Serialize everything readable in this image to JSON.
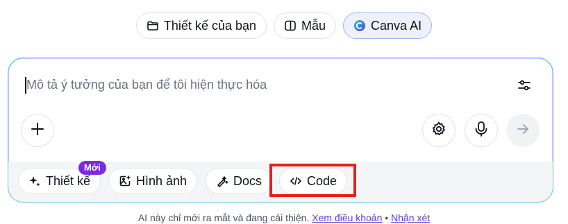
{
  "tabs": [
    {
      "label": "Thiết kế của bạn",
      "icon": "folder-icon"
    },
    {
      "label": "Mẫu",
      "icon": "template-icon"
    },
    {
      "label": "Canva AI",
      "icon": "canva-ai-icon",
      "active": true
    }
  ],
  "prompt": {
    "placeholder": "Mô tả ý tưởng của bạn để tôi hiện thực hóa"
  },
  "chips": [
    {
      "label": "Thiết kế",
      "icon": "sparkle-icon"
    },
    {
      "label": "Hình ảnh",
      "icon": "image-icon"
    },
    {
      "label": "Docs",
      "icon": "magic-pen-icon"
    },
    {
      "label": "Code",
      "icon": "code-icon"
    }
  ],
  "badge": "Mới",
  "footer": {
    "text": "AI này chỉ mới ra mắt và đang cải thiện.",
    "terms_link": "Xem điều khoản",
    "separator": "•",
    "feedback_link": "Nhận xét"
  },
  "colors": {
    "accent_purple": "#7d2ae8",
    "border_teal": "#54c8d8",
    "highlight_red": "#ee1c1c"
  }
}
